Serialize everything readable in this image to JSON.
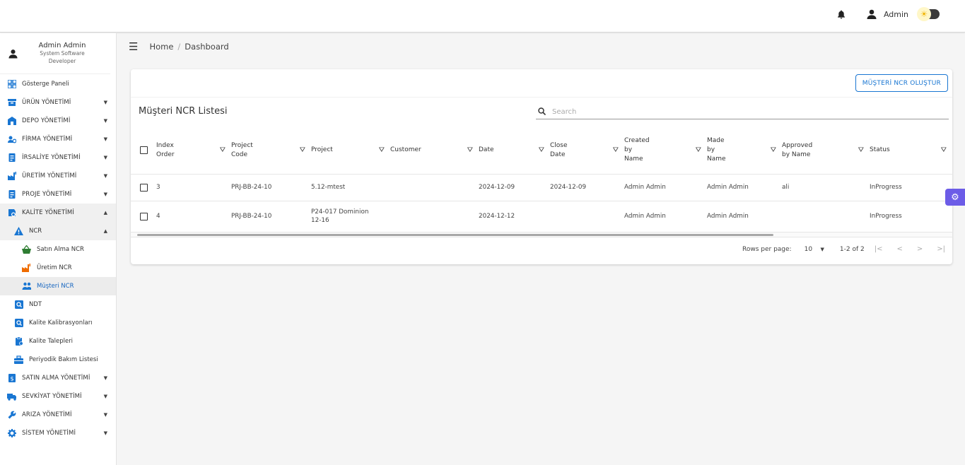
{
  "topbar": {
    "bell_icon": "bell-icon",
    "user_icon": "user-icon",
    "username": "Admin",
    "theme_toggle_icon": "sun-icon"
  },
  "profile": {
    "name": "Admin Admin",
    "role_line1": "System Software",
    "role_line2": "Developer"
  },
  "sidebar": {
    "items": [
      {
        "label": "Gösterge Paneli",
        "icon": "dashboard-icon",
        "color": "#1976d2"
      },
      {
        "label": "ÜRÜN YÖNETİMİ",
        "icon": "box-icon",
        "color": "#1976d2"
      },
      {
        "label": "DEPO YÖNETİMİ",
        "icon": "warehouse-icon",
        "color": "#1976d2"
      },
      {
        "label": "FİRMA YÖNETİMİ",
        "icon": "company-icon",
        "color": "#1976d2"
      },
      {
        "label": "İRSALİYE YÖNETİMİ",
        "icon": "document-icon",
        "color": "#1976d2"
      },
      {
        "label": "ÜRETİM YÖNETİMİ",
        "icon": "factory-icon",
        "color": "#1976d2"
      },
      {
        "label": "PROJE YÖNETİMİ",
        "icon": "document-icon",
        "color": "#1976d2"
      },
      {
        "label": "KALİTE YÖNETİMİ",
        "icon": "quality-icon",
        "color": "#1976d2"
      },
      {
        "label": "NCR",
        "icon": "warning-icon",
        "color": "#1976d2"
      },
      {
        "label": "Satın Alma NCR",
        "icon": "basket-icon",
        "color": "#2e7d32"
      },
      {
        "label": "Üretim NCR",
        "icon": "factory-icon",
        "color": "#ef6c00"
      },
      {
        "label": "Müşteri NCR",
        "icon": "people-icon",
        "color": "#1976d2"
      },
      {
        "label": "NDT",
        "icon": "search-doc-icon",
        "color": "#1976d2"
      },
      {
        "label": "Kalite Kalibrasyonları",
        "icon": "search-doc-icon",
        "color": "#1976d2"
      },
      {
        "label": "Kalite Talepleri",
        "icon": "clipboard-icon",
        "color": "#1976d2"
      },
      {
        "label": "Periyodik Bakım Listesi",
        "icon": "toolbox-icon",
        "color": "#1976d2"
      },
      {
        "label": "SATIN ALMA YÖNETİMİ",
        "icon": "purchase-icon",
        "color": "#1976d2"
      },
      {
        "label": "SEVKİYAT YÖNETİMİ",
        "icon": "truck-icon",
        "color": "#1976d2"
      },
      {
        "label": "ARIZA YÖNETİMİ",
        "icon": "wrench-icon",
        "color": "#1976d2"
      },
      {
        "label": "SİSTEM YÖNETİMİ",
        "icon": "gear-icon",
        "color": "#1976d2"
      }
    ]
  },
  "breadcrumb": {
    "home": "Home",
    "separator": "/",
    "current": "Dashboard"
  },
  "card": {
    "create_button": "MÜŞTERİ NCR OLUŞTUR",
    "title": "Müşteri NCR Listesi",
    "search_placeholder": "Search"
  },
  "table": {
    "headers": [
      [
        "Index",
        "Order"
      ],
      [
        "Project",
        "Code"
      ],
      [
        "Project"
      ],
      [
        "Customer"
      ],
      [
        "Date"
      ],
      [
        "Close",
        "Date"
      ],
      [
        "Created",
        "by",
        "Name"
      ],
      [
        "Made",
        "by",
        "Name"
      ],
      [
        "Approved",
        "by Name"
      ],
      [
        "Status"
      ]
    ],
    "rows": [
      [
        "3",
        "PRJ-BB-24-10",
        "5.12-mtest",
        "",
        "2024-12-09",
        "2024-12-09",
        "Admin Admin",
        "Admin Admin",
        "ali",
        "InProgress"
      ],
      [
        "4",
        "PRJ-BB-24-10",
        "P24-017 Dominion 12-16",
        "",
        "2024-12-12",
        "",
        "Admin Admin",
        "Admin Admin",
        "",
        "InProgress"
      ]
    ]
  },
  "pager": {
    "rows_per_page_label": "Rows per page:",
    "rows_per_page_value": "10",
    "range": "1-2 of 2"
  },
  "colors": {
    "accent": "#1976d2",
    "float_button": "#6c5ce7"
  }
}
